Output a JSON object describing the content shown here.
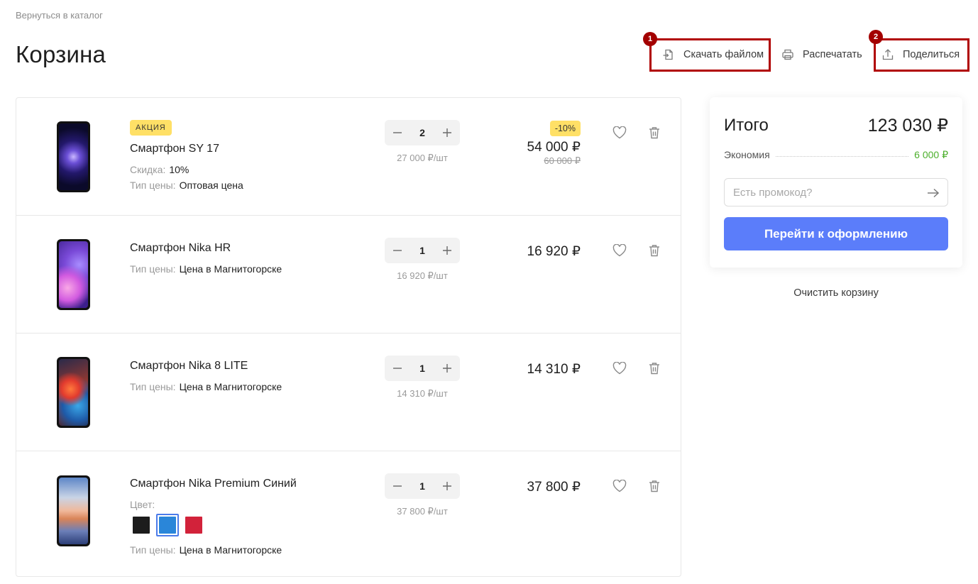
{
  "nav": {
    "back_label": "Вернуться в каталог"
  },
  "page": {
    "title": "Корзина"
  },
  "actions": {
    "download_label": "Скачать файлом",
    "print_label": "Распечатать",
    "share_label": "Поделиться"
  },
  "annotations": {
    "first": "1",
    "second": "2"
  },
  "cart": {
    "items": [
      {
        "promo_tag": "Акция",
        "name": "Смартфон SY 17",
        "discount_key": "Скидка:",
        "discount_value": "10%",
        "price_type_key": "Тип цены:",
        "price_type_value": "Оптовая цена",
        "quantity": "2",
        "unit_price": "27 000 ₽/шт",
        "discount_badge": "-10%",
        "total": "54 000 ₽",
        "old_total": "60 000 ₽"
      },
      {
        "name": "Смартфон Nika HR",
        "price_type_key": "Тип цены:",
        "price_type_value": "Цена в Магнитогорске",
        "quantity": "1",
        "unit_price": "16 920 ₽/шт",
        "total": "16 920 ₽"
      },
      {
        "name": "Смартфон Nika 8 LITE",
        "price_type_key": "Тип цены:",
        "price_type_value": "Цена в Магнитогорске",
        "quantity": "1",
        "unit_price": "14 310 ₽/шт",
        "total": "14 310 ₽"
      },
      {
        "name": "Смартфон Nika Premium Синий",
        "color_key": "Цвет:",
        "colors": [
          "#1c1c1c",
          "#2a86d9",
          "#d2223a"
        ],
        "selected_color_index": 1,
        "price_type_key": "Тип цены:",
        "price_type_value": "Цена в Магнитогорске",
        "quantity": "1",
        "unit_price": "37 800 ₽/шт",
        "total": "37 800 ₽"
      }
    ]
  },
  "summary": {
    "title": "Итого",
    "total": "123 030 ₽",
    "savings_label": "Экономия",
    "savings_value": "6 000 ₽",
    "promo_placeholder": "Есть промокод?",
    "checkout_label": "Перейти к оформлению",
    "clear_label": "Очистить корзину"
  },
  "colors": {
    "accent": "#5b7dfa",
    "savings": "#4caf2c",
    "promo_badge": "#ffe066",
    "annotation": "#b00000"
  },
  "icons": [
    "download-icon",
    "printer-icon",
    "share-icon",
    "minus-icon",
    "plus-icon",
    "heart-icon",
    "trash-icon",
    "arrow-right-icon"
  ]
}
